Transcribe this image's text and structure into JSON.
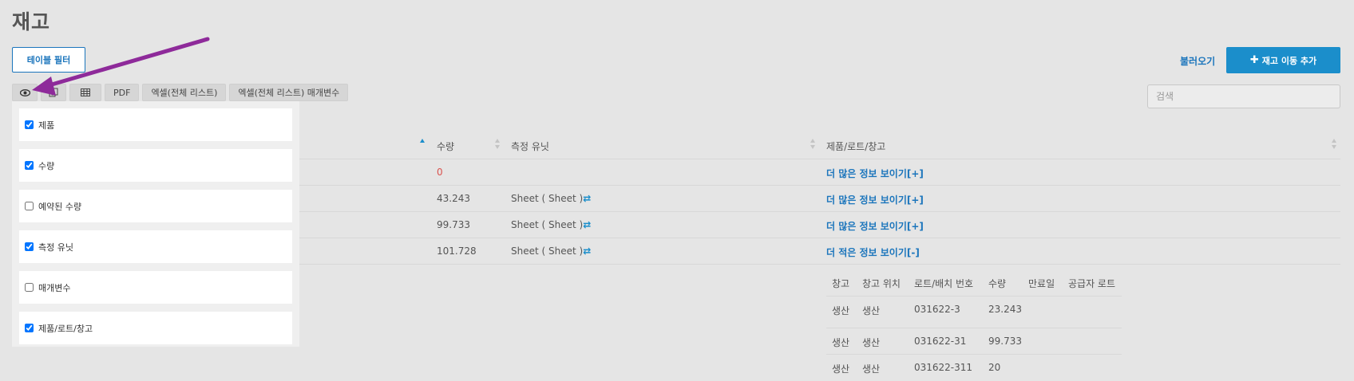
{
  "page": {
    "title": "재고"
  },
  "toolbar": {
    "filter_label": "테이블 필터",
    "load_label": "불러오기",
    "add_label": "재고 이동 추가",
    "add_icon": "plus-icon",
    "pdf_label": "PDF",
    "excel_all_label": "엑셀(전체 리스트)",
    "excel_params_label": "엑셀(전체 리스트) 매개변수"
  },
  "search": {
    "placeholder": "검색"
  },
  "table": {
    "headers": {
      "qty": "수량",
      "unit": "측정 유닛",
      "product_lot_warehouse": "제품/로트/창고"
    },
    "rows": [
      {
        "qty": "0",
        "unit": "",
        "unit_icon": "",
        "more": "더 많은 정보 보이기[+]"
      },
      {
        "qty": "43.243",
        "unit": "Sheet ( Sheet )",
        "unit_icon": "⇄",
        "more": "더 많은 정보 보이기[+]"
      },
      {
        "qty": "99.733",
        "unit": "Sheet ( Sheet )",
        "unit_icon": "⇄",
        "more": "더 많은 정보 보이기[+]"
      },
      {
        "qty": "101.728",
        "unit": "Sheet ( Sheet )",
        "unit_icon": "⇄",
        "more": "더 적은 정보 보이기[-]"
      }
    ]
  },
  "subtable": {
    "headers": [
      "창고",
      "창고 위치",
      "로트/배치 번호",
      "수량",
      "만료일",
      "공급자 로트"
    ],
    "rows": [
      [
        "생산",
        "생산",
        "031622-3",
        "23.243",
        "",
        ""
      ],
      [
        "생산",
        "생산",
        "031622-31",
        "99.733",
        "",
        ""
      ],
      [
        "생산",
        "생산",
        "031622-311",
        "20",
        "",
        ""
      ]
    ]
  },
  "column_picker": {
    "items": [
      {
        "label": "제품",
        "checked": true
      },
      {
        "label": "수량",
        "checked": true
      },
      {
        "label": "예약된 수량",
        "checked": false
      },
      {
        "label": "측정 유닛",
        "checked": true
      },
      {
        "label": "매개변수",
        "checked": false
      },
      {
        "label": "제품/로트/창고",
        "checked": true
      }
    ]
  },
  "colors": {
    "accent": "#1b8ecb",
    "link": "#1b75bc",
    "zero": "#d9534f",
    "annotation_arrow": "#8e2a9a"
  }
}
